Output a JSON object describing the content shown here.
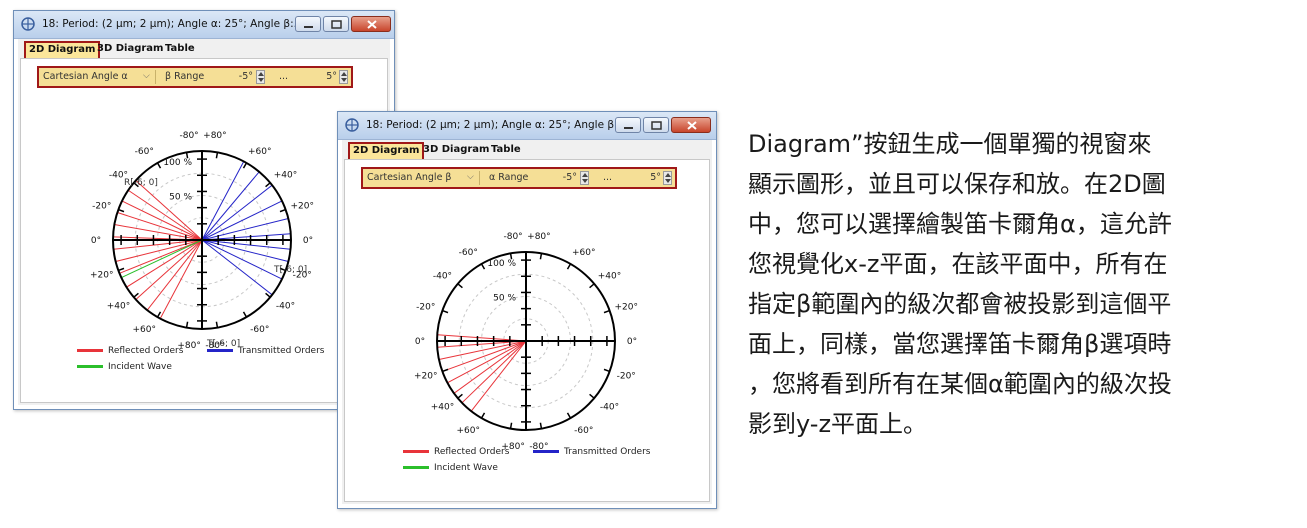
{
  "colors": {
    "reflected": "#e8343a",
    "transmitted": "#2424c8",
    "incident": "#2bbf2b",
    "highlight": "#a01818",
    "toolbar_bg": "#f5df96"
  },
  "windows": [
    {
      "title": "18: Period: (2 µm; 2 µm); Angle α: 25°; Angle β:...",
      "tabs": [
        "2D Diagram",
        "3D Diagram",
        "Table"
      ],
      "active_tab": "2D Diagram",
      "angle_select": "Cartesian Angle α",
      "range_label": "β Range",
      "range_from": "-5°",
      "range_dots": "...",
      "range_to": "5°",
      "chart_data": {
        "type": "polar",
        "radial_label": "50 %",
        "outer_label": "100 %",
        "angle_labels": [
          "-80°",
          "+80°",
          "-60°",
          "+60°",
          "-40°",
          "+40°",
          "-20°",
          "+20°",
          "0°",
          "0°",
          "+20°",
          "-20°",
          "+40°",
          "-40°",
          "+60°",
          "-60°",
          "+80°",
          "-80°"
        ],
        "annotations": [
          "R[-6; 0]",
          "T[-6; 0]",
          "T[-6; 0]"
        ],
        "reflected_angles_deg": [
          -62,
          -52,
          -42,
          -32,
          -22,
          -14,
          -6,
          2,
          10,
          18,
          26,
          34,
          42
        ],
        "transmitted_angles_deg": [
          -62,
          -50,
          -38,
          -26,
          -14,
          -4,
          6,
          14,
          26,
          38
        ],
        "incident_angle_deg": 25,
        "legend": [
          "Reflected Orders",
          "Transmitted Orders",
          "Incident Wave"
        ]
      }
    },
    {
      "title": "18: Period: (2 µm; 2 µm); Angle α: 25°; Angle β:...",
      "tabs": [
        "2D Diagram",
        "3D Diagram",
        "Table"
      ],
      "active_tab": "2D Diagram",
      "angle_select": "Cartesian Angle β",
      "range_label": "α Range",
      "range_from": "-5°",
      "range_dots": "...",
      "range_to": "5°",
      "chart_data": {
        "type": "polar",
        "radial_label": "50 %",
        "outer_label": "100 %",
        "angle_labels": [
          "-80°",
          "+80°",
          "-60°",
          "+60°",
          "-40°",
          "+40°",
          "-20°",
          "+20°",
          "0°",
          "0°",
          "+20°",
          "-20°",
          "+40°",
          "-40°",
          "+60°",
          "-60°",
          "+80°",
          "-80°"
        ],
        "annotations": [],
        "reflected_angles_deg": [
          -52,
          -44,
          -36,
          -28,
          -20,
          -12,
          -4,
          4
        ],
        "transmitted_angles_deg": [
          0
        ],
        "incident_angle_deg": null,
        "legend": [
          "Reflected Orders",
          "Transmitted Orders",
          "Incident Wave"
        ]
      }
    }
  ],
  "caption": {
    "lines": [
      "Diagram”按鈕生成一個單獨的視窗來",
      "顯示圖形，並且可以保存和放。在2D圖",
      "中，您可以選擇繪製笛卡爾角α，這允許",
      "您視覺化x-z平面，在該平面中，所有在",
      "指定β範圍內的級次都會被投影到這個平",
      "面上，同樣，當您選擇笛卡爾角β選項時",
      "，您將看到所有在某個α範圍內的級次投",
      "影到y-z平面上。"
    ]
  }
}
